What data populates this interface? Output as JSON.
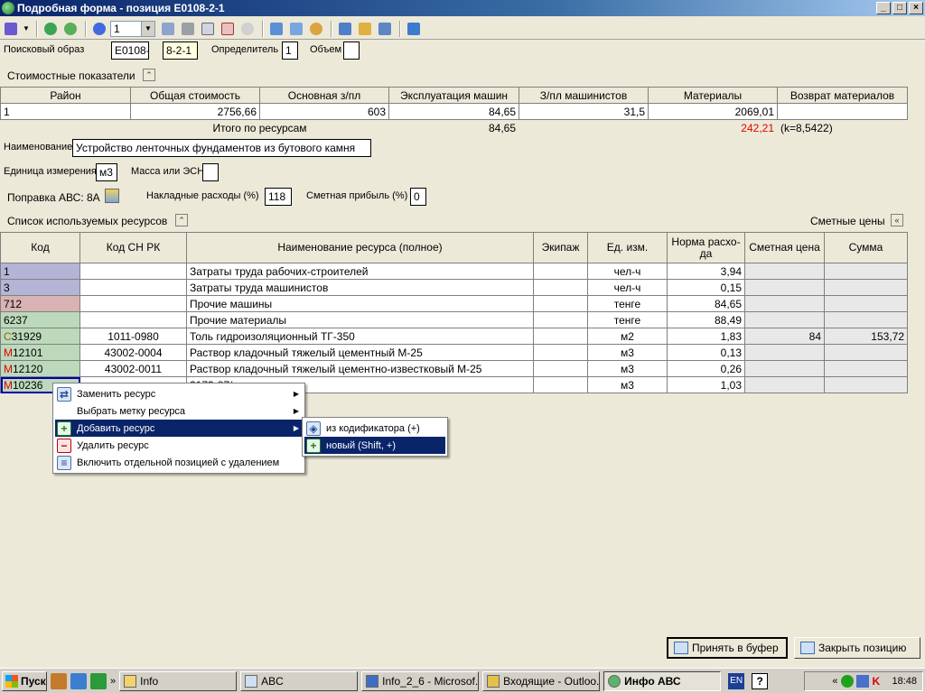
{
  "window": {
    "title": "Подробная форма - позиция E0108-2-1"
  },
  "toolbar": {
    "combo_value": "1"
  },
  "search": {
    "label": "Поисковый образ",
    "value": "E0108-2-1",
    "short_value": "8-2-1",
    "determinant_label": "Определитель",
    "determinant_value": "1",
    "volume_label": "Объем",
    "volume_value": ""
  },
  "cost_section": {
    "title": "Стоимостные показатели"
  },
  "cost_table": {
    "headers": [
      "Район",
      "Общая стоимость",
      "Основная з/пл",
      "Эксплуатация машин",
      "З/пл машинистов",
      "Материалы",
      "Возврат материалов"
    ],
    "row": [
      "1",
      "2756,66",
      "603",
      "84,65",
      "31,5",
      "2069,01",
      ""
    ],
    "total_label": "Итого по ресурсам",
    "total_machines": "84,65",
    "total_materials": "242,21",
    "total_k": "(k=8,5422)"
  },
  "name": {
    "label": "Наименование",
    "value": "Устройство ленточных фундаментов из бутового камня"
  },
  "unit": {
    "label": "Единица измерения",
    "value": "м3",
    "mass_label": "Масса или ЭСН",
    "mass_value": ""
  },
  "abc": {
    "label": "Поправка АВС: 8А"
  },
  "overhead": {
    "label": "Накладные расходы (%)",
    "value": "118",
    "profit_label": "Сметная прибыль (%)",
    "profit_value": "0"
  },
  "resources_section": {
    "title": "Список используемых ресурсов",
    "prices_label": "Сметные цены"
  },
  "res_table": {
    "headers": [
      "Код",
      "Код СН РК",
      "Наименование ресурса (полное)",
      "Экипаж",
      "Ед. изм.",
      "Норма расхо-да",
      "Сметная цена",
      "Сумма"
    ],
    "rows": [
      {
        "prefix": "",
        "code": "1",
        "sn": "",
        "name": "Затраты труда рабочих-строителей",
        "crew": "",
        "unit": "чел-ч",
        "norm": "3,94",
        "price": "",
        "sum": ""
      },
      {
        "prefix": "",
        "code": "3",
        "sn": "",
        "name": "Затраты труда машинистов",
        "crew": "",
        "unit": "чел-ч",
        "norm": "0,15",
        "price": "",
        "sum": ""
      },
      {
        "prefix": "",
        "code": "712",
        "sn": "",
        "name": "Прочие машины",
        "crew": "",
        "unit": "тенге",
        "norm": "84,65",
        "price": "",
        "sum": ""
      },
      {
        "prefix": "",
        "code": "6237",
        "sn": "",
        "name": "Прочие материалы",
        "crew": "",
        "unit": "тенге",
        "norm": "88,49",
        "price": "",
        "sum": ""
      },
      {
        "prefix": "C",
        "code": "31929",
        "sn": "1011-0980",
        "name": "Толь гидроизоляционный ТГ-350",
        "crew": "",
        "unit": "м2",
        "norm": "1,83",
        "price": "84",
        "sum": "153,72"
      },
      {
        "prefix": "M",
        "code": "12101",
        "sn": "43002-0004",
        "name": "Раствор кладочный тяжелый цементный М-25",
        "crew": "",
        "unit": "м3",
        "norm": "0,13",
        "price": "",
        "sum": ""
      },
      {
        "prefix": "M",
        "code": "12120",
        "sn": "43002-0011",
        "name": "Раствор кладочный тяжелый цементно-известковый М-25",
        "crew": "",
        "unit": "м3",
        "norm": "0,26",
        "price": "",
        "sum": ""
      },
      {
        "prefix": "M",
        "code": "10236",
        "sn": "",
        "name": "2173-87/",
        "crew": "",
        "unit": "м3",
        "norm": "1,03",
        "price": "",
        "sum": ""
      }
    ]
  },
  "context_menu": {
    "items": [
      "Заменить ресурс",
      "Выбрать метку ресурса",
      "Добавить ресурс",
      "Удалить ресурс",
      "Включить отдельной позицией с удалением"
    ]
  },
  "submenu": {
    "items": [
      "из кодификатора (+)",
      "новый (Shift, +)"
    ]
  },
  "buttons": {
    "accept": "Принять в буфер",
    "close": "Закрыть позицию"
  },
  "taskbar": {
    "start": "Пуск",
    "tasks": [
      "Info",
      "ABC",
      "Info_2_6 - Microsof...",
      "Входящие - Outloo...",
      "Инфо АВС"
    ],
    "lang": "EN",
    "clock": "18:48"
  },
  "colors": {
    "title_bar": "#0a246a",
    "highlight": "#0a246a",
    "red_value": "#e00000"
  }
}
